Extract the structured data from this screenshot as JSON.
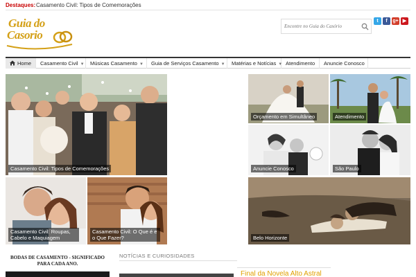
{
  "topbar": {
    "highlight_label": "Destaques:",
    "highlight_link": "Casamento Civil: Tipos de Comemorações"
  },
  "logo": {
    "line1": "Guia do",
    "line2": "Casorio"
  },
  "search": {
    "placeholder": "Encontre no Guia do Casório"
  },
  "social": {
    "twitter": "t",
    "facebook": "f",
    "googleplus": "g+",
    "youtube": "▶"
  },
  "nav": {
    "items": [
      {
        "label": "Home"
      },
      {
        "label": "Casamento Civil"
      },
      {
        "label": "Músicas Casamento"
      },
      {
        "label": "Guia de Serviços Casamento"
      },
      {
        "label": "Matérias e Notícias"
      },
      {
        "label": "Atendimento"
      },
      {
        "label": "Anuncie Conosco"
      }
    ]
  },
  "featured": {
    "main": "Casamento Civil: Tipos de Comemorações",
    "bottom_left": "Casamento Civil: Roupas, Cabelo e Maquiagem",
    "bottom_mid": "Casamento Civil: O Que é e o Que Fazer?",
    "right_1": "Orçamento em Simultâneo",
    "right_2": "Atendimento",
    "right_3": "Anuncie Conosco",
    "right_4": "São Paulo",
    "right_5": "Belo Horizonte"
  },
  "sections": {
    "bodas_title": "BODAS DE CASAMENTO - SIGNIFICADO PARA CADA ANO.",
    "noticias_title": "NOTÍCIAS E CURIOSIDADES",
    "headline": "Final da Novela Alto Astral"
  },
  "colors": {
    "accent": "#d4a017",
    "highlight_red": "#c80000",
    "headline_orange": "#e0a000"
  }
}
